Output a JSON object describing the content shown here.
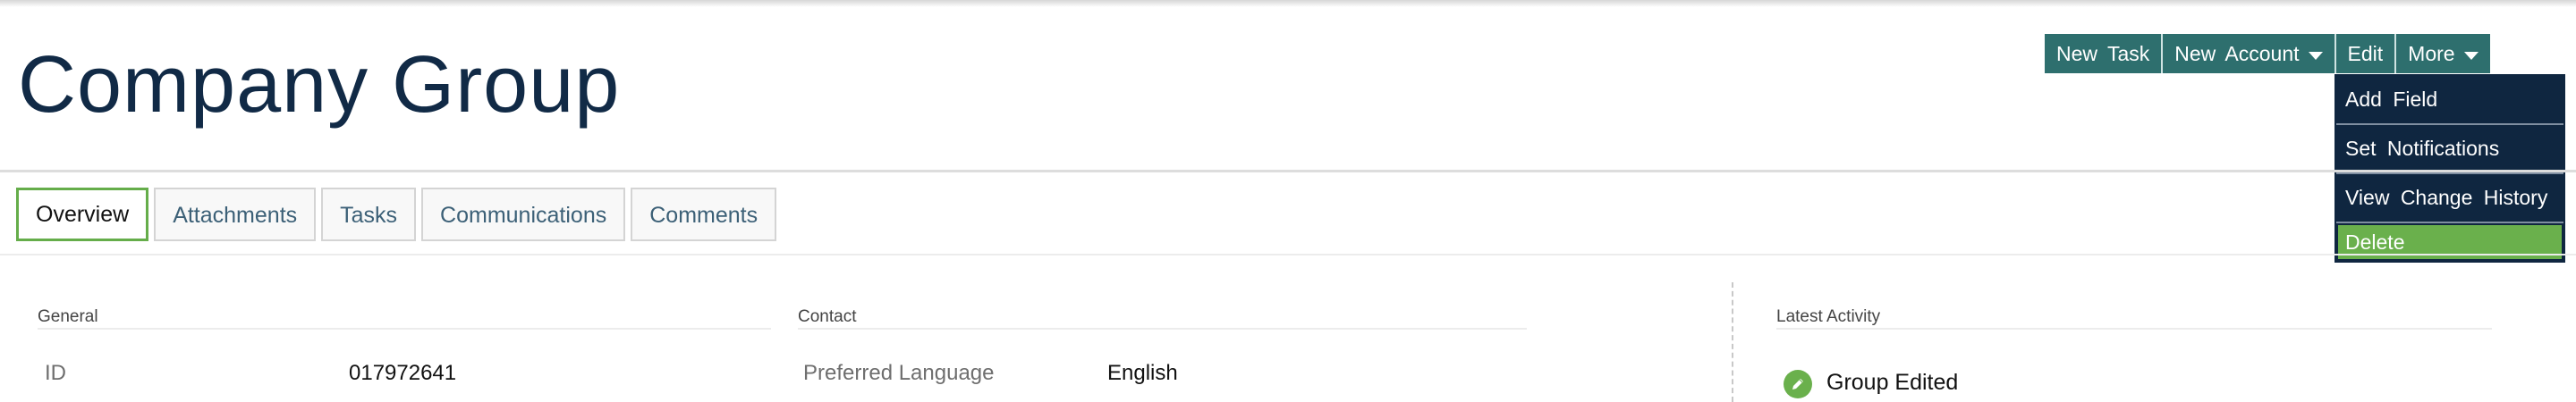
{
  "page": {
    "title": "Company Group"
  },
  "actions": {
    "new_task": "New Task",
    "new_account": "New Account",
    "edit": "Edit",
    "more": "More"
  },
  "more_menu": {
    "items": [
      "Add Field",
      "Set Notifications",
      "View Change History",
      "Delete"
    ]
  },
  "tabs": [
    "Overview",
    "Attachments",
    "Tasks",
    "Communications",
    "Comments"
  ],
  "sections": {
    "general": {
      "label": "General",
      "fields": [
        {
          "label": "ID",
          "value": "017972641"
        }
      ]
    },
    "contact": {
      "label": "Contact",
      "fields": [
        {
          "label": "Preferred Language",
          "value": "English"
        }
      ]
    },
    "latest_activity": {
      "label": "Latest Activity",
      "items": [
        {
          "icon": "pencil-icon",
          "text": "Group Edited"
        }
      ]
    }
  },
  "colors": {
    "accent_teal": "#2e6f6e",
    "menu_navy": "#0f2640",
    "active_green": "#6ab04c",
    "title_navy": "#112a46"
  }
}
